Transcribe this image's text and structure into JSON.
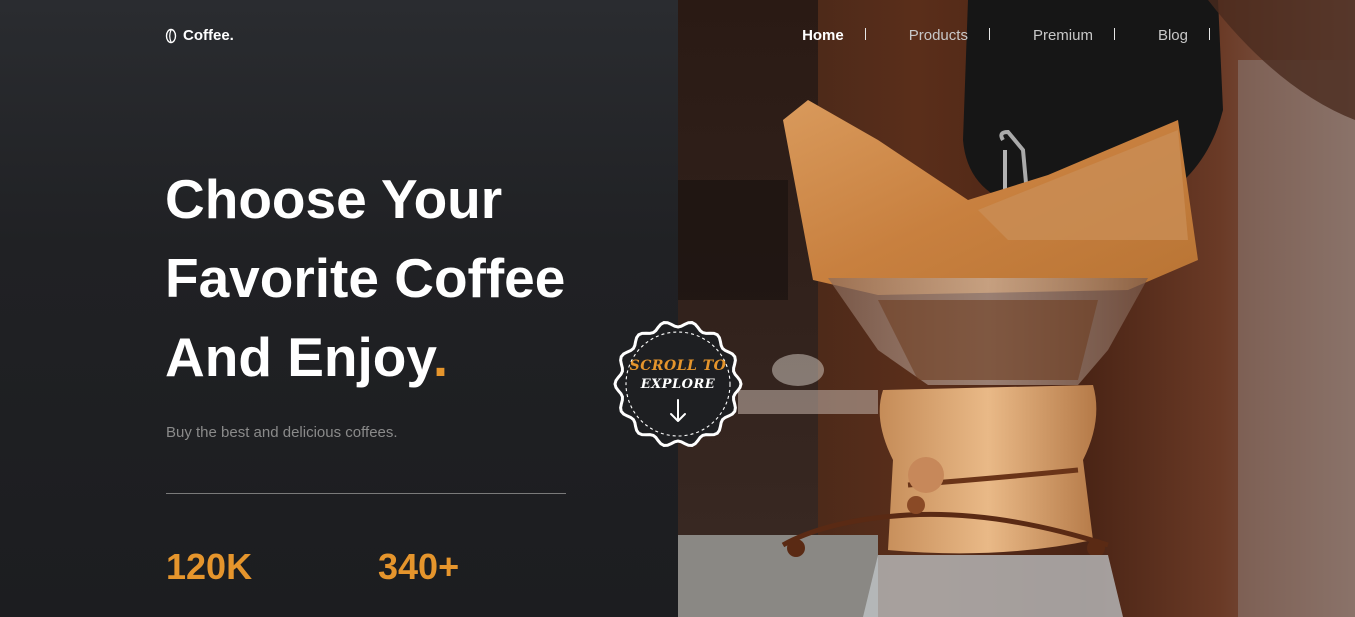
{
  "brand": {
    "name": "Coffee.",
    "icon": "coffee-bean-icon"
  },
  "nav": {
    "items": [
      {
        "label": "Home",
        "active": true
      },
      {
        "label": "Products",
        "active": false
      },
      {
        "label": "Premium",
        "active": false
      },
      {
        "label": "Blog",
        "active": false
      }
    ]
  },
  "hero": {
    "title_lines": [
      "Choose Your",
      "Favorite Coffee",
      "And Enjoy"
    ],
    "title_dot": ".",
    "subtitle": "Buy the best and delicious coffees.",
    "stats": [
      {
        "value": "120K"
      },
      {
        "value": "340+"
      }
    ]
  },
  "scroll_badge": {
    "line1": "SCROLL TO",
    "line2": "EXPLORE",
    "icon": "arrow-down-icon"
  },
  "colors": {
    "accent": "#e5952c",
    "background": "#1d1e21",
    "text": "#ffffff",
    "muted": "#8a8a8a"
  },
  "hero_image": {
    "icon": "coffee-pour-over-photo"
  }
}
